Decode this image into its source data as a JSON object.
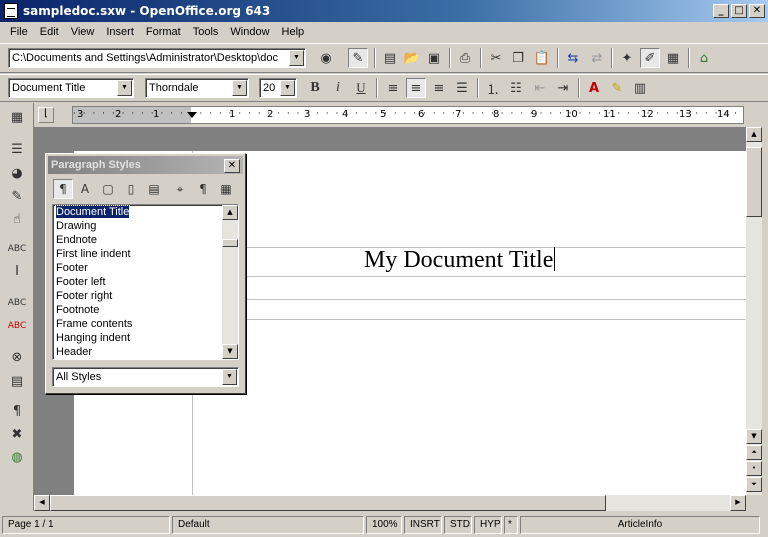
{
  "window": {
    "title": "sampledoc.sxw - OpenOffice.org 643",
    "minimize": "_",
    "maximize": "□",
    "close": "✕"
  },
  "menu": [
    "File",
    "Edit",
    "View",
    "Insert",
    "Format",
    "Tools",
    "Window",
    "Help"
  ],
  "toolbar": {
    "path_value": "C:\\Documents and Settings\\Administrator\\Desktop\\doc",
    "paragraph_style": "Document Title",
    "font_name": "Thorndale",
    "font_size": "20"
  },
  "ruler": {
    "numbers": [
      "3",
      "2",
      "1",
      "1",
      "2",
      "3",
      "4",
      "5",
      "6",
      "7",
      "8",
      "9",
      "10",
      "11",
      "12",
      "13",
      "14"
    ]
  },
  "document": {
    "title_text": "My Document Title"
  },
  "stylist": {
    "title": "Paragraph Styles",
    "close": "✕",
    "items": [
      "Document Title",
      "Drawing",
      "Endnote",
      "First line indent",
      "Footer",
      "Footer left",
      "Footer right",
      "Footnote",
      "Frame contents",
      "Hanging indent",
      "Header"
    ],
    "selected_index": 0,
    "filter": "All Styles"
  },
  "status": {
    "page": "Page 1 / 1",
    "page_style": "Default",
    "zoom": "100%",
    "insert_mode": "INSRT",
    "selection_mode": "STD",
    "hyperlink_mode": "HYP",
    "modified": "*",
    "info": "ArticleInfo"
  },
  "icons": {
    "left_toolbar": [
      "insert-icon",
      "insert-fields-icon",
      "insert-objects-icon",
      "show-draw-functions-icon",
      "form-functions-icon",
      "edit-autotext-icon",
      "text-cursor-icon",
      "spellcheck-icon",
      "autospellcheck-icon",
      "find-replace-icon",
      "data-sources-icon",
      "nonprinting-characters-icon",
      "online-layout-icon",
      "navigator-globe-icon"
    ]
  }
}
